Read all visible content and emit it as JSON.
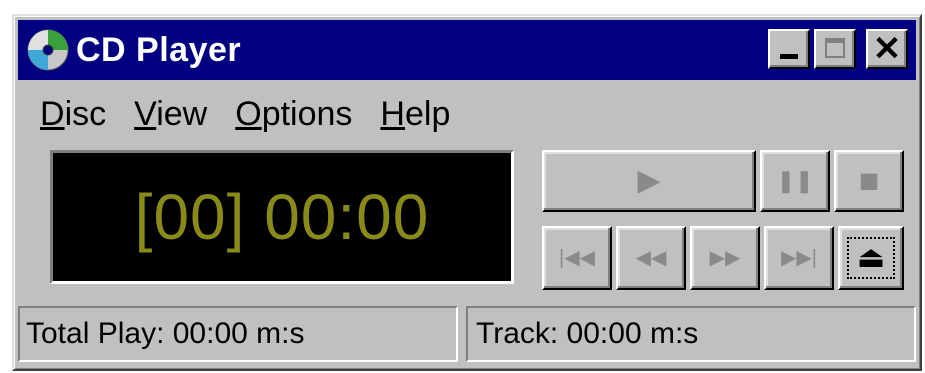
{
  "window": {
    "title": "CD Player",
    "icon": "cd-icon",
    "controls": [
      "minimize-icon",
      "maximize-icon",
      "close-icon"
    ],
    "close_glyph": "✕"
  },
  "menubar": {
    "items": [
      {
        "mnemonic": "D",
        "rest": "isc"
      },
      {
        "mnemonic": "V",
        "rest": "iew"
      },
      {
        "mnemonic": "O",
        "rest": "ptions"
      },
      {
        "mnemonic": "H",
        "rest": "elp"
      }
    ]
  },
  "display": {
    "text": "[00] 00:00",
    "text_color": "#8a8a1a",
    "background": "#000000"
  },
  "controls": {
    "play": {
      "icon": "play-icon",
      "glyph": "▶"
    },
    "pause": {
      "icon": "pause-icon",
      "glyph": "❚❚"
    },
    "stop": {
      "icon": "stop-icon",
      "glyph": "■"
    },
    "previous_track": {
      "icon": "previous-track-icon",
      "glyph": "|◀◀"
    },
    "skip_backwards": {
      "icon": "skip-backwards-icon",
      "glyph": "◀◀"
    },
    "skip_forwards": {
      "icon": "skip-forwards-icon",
      "glyph": "▶▶"
    },
    "next_track": {
      "icon": "next-track-icon",
      "glyph": "▶▶|"
    },
    "eject": {
      "icon": "eject-icon",
      "glyph": "⏏"
    }
  },
  "statusbar": {
    "total_play": "Total Play: 00:00 m:s",
    "track": "Track: 00:00 m:s"
  },
  "colors": {
    "titlebar": "#000080",
    "face": "#c0c0c0"
  }
}
